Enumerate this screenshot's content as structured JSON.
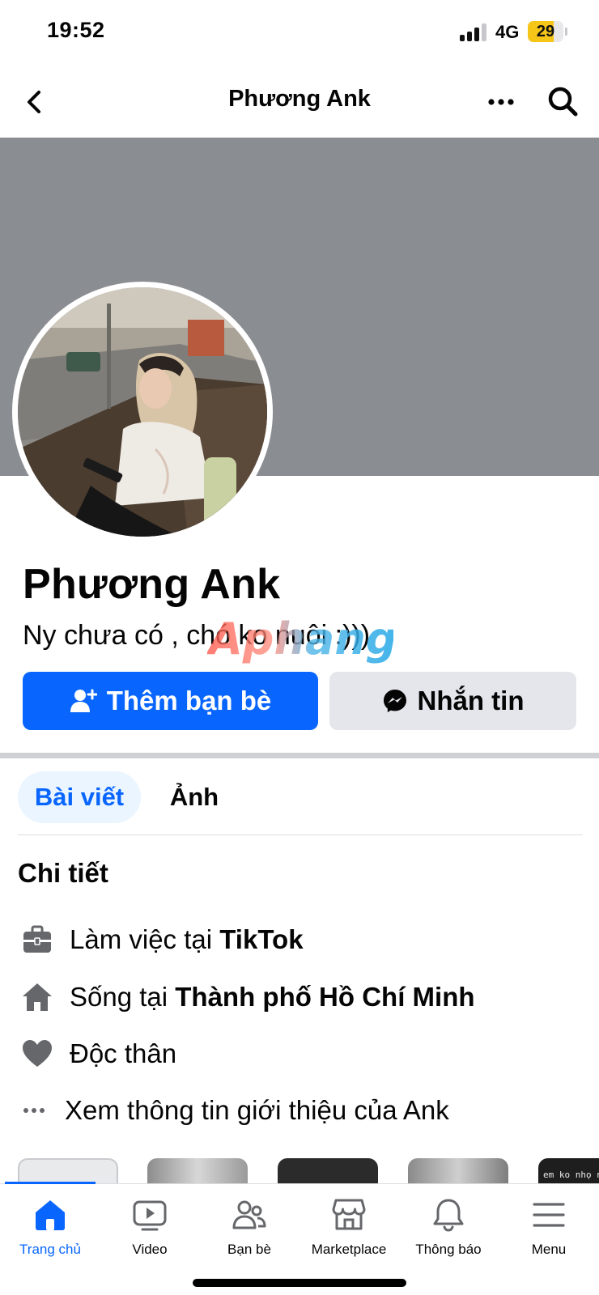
{
  "status_bar": {
    "time": "19:52",
    "network": "4G",
    "battery": "29"
  },
  "header": {
    "title": "Phương Ank",
    "back_icon": "chevron-left-icon",
    "more_icon": "more-horizontal-icon",
    "search_icon": "search-icon"
  },
  "profile": {
    "name": "Phương Ank",
    "bio": "Ny chưa có , chó ko nuôi :)))",
    "watermark": "Aphang"
  },
  "actions": {
    "add_friend_label": "Thêm bạn bè",
    "message_label": "Nhắn tin"
  },
  "tabs": [
    {
      "label": "Bài viết",
      "active": true
    },
    {
      "label": "Ảnh",
      "active": false
    }
  ],
  "details": {
    "title": "Chi tiết",
    "work": {
      "prefix": "Làm việc tại ",
      "value": "TikTok"
    },
    "lives": {
      "prefix": "Sống tại ",
      "value": "Thành phố Hồ Chí Minh"
    },
    "relationship": "Độc thân",
    "more": "Xem thông tin giới thiệu của Ank"
  },
  "photo_strip": {
    "thumb_texts": [
      "em ko nhọ nh"
    ]
  },
  "bottom_nav": [
    {
      "label": "Trang chủ",
      "icon": "home-icon",
      "active": true
    },
    {
      "label": "Video",
      "icon": "video-icon",
      "active": false
    },
    {
      "label": "Bạn bè",
      "icon": "friends-icon",
      "active": false
    },
    {
      "label": "Marketplace",
      "icon": "marketplace-icon",
      "active": false
    },
    {
      "label": "Thông báo",
      "icon": "bell-icon",
      "active": false
    },
    {
      "label": "Menu",
      "icon": "menu-icon",
      "active": false
    }
  ],
  "colors": {
    "accent": "#0866ff",
    "cover": "#8a8d91",
    "secondary_button": "#e4e6eb",
    "tab_active_bg": "#ebf5ff"
  }
}
